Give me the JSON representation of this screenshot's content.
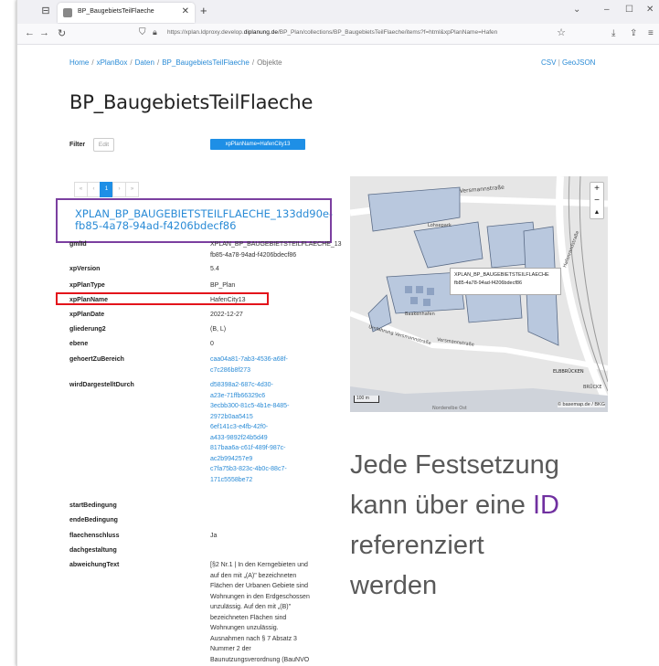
{
  "browser": {
    "tab_title": "BP_BaugebietsTeilFlaeche",
    "url_prefix": "https://xplan.ldproxy.develop.",
    "url_domain": "diplanung.de",
    "url_path": "/BP_Plan/collections/BP_BaugebietsTeilFlaeche/items?f=html&xpPlanName=Hafen"
  },
  "breadcrumb": {
    "items": [
      "Home",
      "xPlanBox",
      "Daten",
      "BP_BaugebietsTeilFlaeche"
    ],
    "current": "Objekte",
    "separator": "/"
  },
  "exports": {
    "csv": "CSV",
    "sep": "|",
    "geojson": "GeoJSON"
  },
  "page_title": "BP_BaugebietsTeilFlaeche",
  "filter": {
    "label": "Filter",
    "edit": "Edit",
    "tag": "xpPlanName=HafenCity13"
  },
  "pager": [
    "«",
    "‹",
    "1",
    "›",
    "»"
  ],
  "feature": {
    "heading": "XPLAN_BP_BAUGEBIETSTEILFLAECHE_133dd90e-fb85-4a78-94ad-f4206bdecf86",
    "properties": [
      {
        "key": "gmlId",
        "lines": [
          "XPLAN_BP_BAUGEBIETSTEILFLAECHE_13",
          "fb85-4a78-94ad-f4206bdecf86"
        ],
        "link": false
      },
      {
        "key": "xpVersion",
        "lines": [
          "5.4"
        ],
        "link": false
      },
      {
        "key": "xpPlanType",
        "lines": [
          "BP_Plan"
        ],
        "link": false
      },
      {
        "key": "xpPlanName",
        "lines": [
          "HafenCity13"
        ],
        "link": false
      },
      {
        "key": "xpPlanDate",
        "lines": [
          "2022-12-27"
        ],
        "link": false
      },
      {
        "key": "gliederung2",
        "lines": [
          "(B, L)"
        ],
        "link": false
      },
      {
        "key": "ebene",
        "lines": [
          "0"
        ],
        "link": false
      },
      {
        "key": "gehoertZuBereich",
        "lines": [
          "caa04a81-7ab3-4536-a68f-",
          "c7c286b8f273"
        ],
        "link": true
      },
      {
        "key": "wirdDargestelltDurch",
        "lines": [
          "d58398a2-687c-4d30-",
          "a23e-71ffb66329c6",
          "3ecbb300-81c5-4b1e-8485-",
          "2972b0aa5415",
          "6ef141c3-e4fb-42f0-",
          "a433-9892f24b5d49",
          "817baa6a-c61f-489f-987c-",
          "ac2b994257e9",
          "c7fa75b3-823c-4b0c-88c7-",
          "171c5558be72"
        ],
        "link": true
      },
      {
        "key": "startBedingung",
        "lines": [],
        "link": false
      },
      {
        "key": "endeBedingung",
        "lines": [],
        "link": false
      },
      {
        "key": "flaechenschluss",
        "lines": [
          "Ja"
        ],
        "link": false
      },
      {
        "key": "dachgestaltung",
        "lines": [],
        "link": false
      },
      {
        "key": "abweichungText",
        "lines": [
          "[§2 Nr.1 | In den Kerngebieten und",
          "auf den mit „(A)\" bezeichneten",
          "Flächen der Urbanen Gebiete sind",
          "Wohnungen in den Erdgeschossen",
          "unzulässig. Auf den mit „(B)\"",
          "bezeichneten Flächen sind",
          "Wohnungen unzulässig.",
          "Ausnahmen nach § 7 Absatz 3",
          "Nummer 2 der",
          "Baunutzungsverordnung (BauNVO"
        ],
        "link": false
      }
    ]
  },
  "map": {
    "popup_lines": [
      "XPLAN_BP_BAUGEBIETSTEILFLAECHE",
      "fb85-4a78-94ad-f4206bdecf86"
    ],
    "labels": [
      "Versmannstraße",
      "Lohsepark",
      "Versmannstraße",
      "Umfahrung Versmannstraße",
      "Baakenhafen",
      "Hafenrandstraße",
      "ELBBRÜCKEN",
      "Norderelbe Ost",
      "BRÜCKE"
    ],
    "scale": "100 m",
    "attribution": "© basemap.de / BKG",
    "zoom_in": "+",
    "zoom_out": "−",
    "compass": "▲"
  },
  "overlay_text": {
    "line1": "Jede Festsetzung",
    "line2_pre": "kann über eine ",
    "line2_id": "ID",
    "line3": "referenziert",
    "line4": "werden"
  },
  "colors": {
    "link": "#2a8bd6",
    "accent_purple": "#7b3fa0",
    "highlight_red": "#e3141b",
    "overlay_text": "#595959",
    "map_polygon": "#b9c8de"
  }
}
